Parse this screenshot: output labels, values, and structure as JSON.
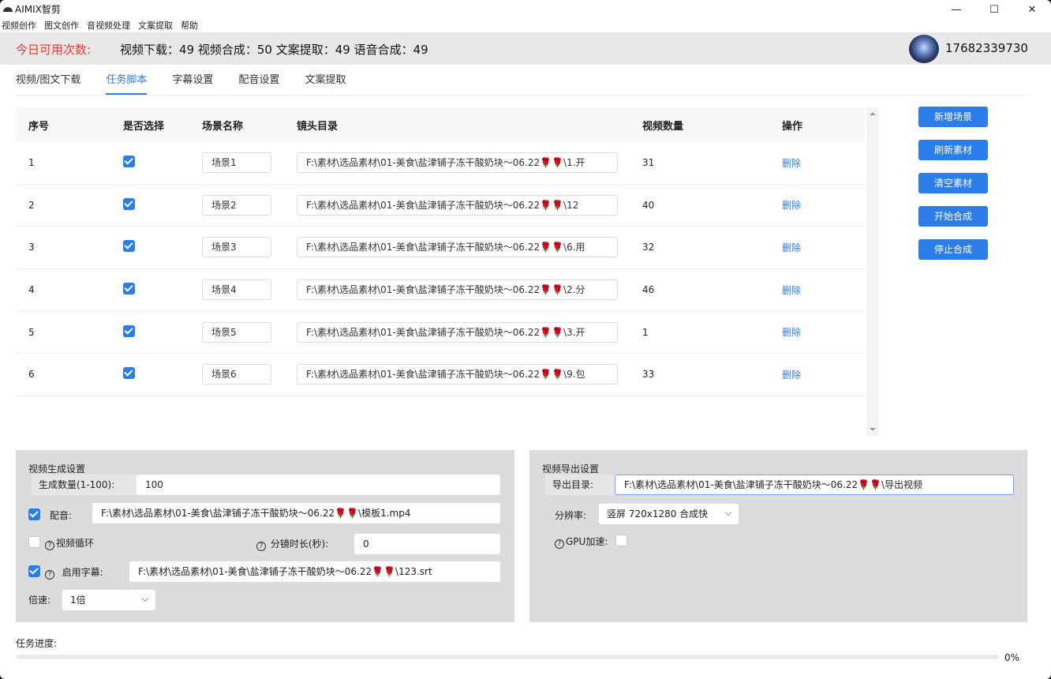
{
  "window": {
    "title": "AIMIX智剪",
    "min_glyph": "—",
    "max_glyph": "☐",
    "close_glyph": "✕"
  },
  "menu": [
    "视频创作",
    "图文创作",
    "音视频处理",
    "文案提取",
    "帮助"
  ],
  "quota": {
    "label": "今日可用次数:",
    "values": "视频下载：49 视频合成：50 文案提取：49 语音合成：49",
    "color": "#e8382f"
  },
  "user": {
    "phone": "17682339730"
  },
  "tabs": [
    "视频/图文下载",
    "任务脚本",
    "字幕设置",
    "配音设置",
    "文案提取"
  ],
  "active_tab": "任务脚本",
  "table": {
    "headers": [
      "序号",
      "是否选择",
      "场景名称",
      "镜头目录",
      "视频数量",
      "操作"
    ],
    "rows": [
      {
        "index": "1",
        "checked": true,
        "scene": "场景1",
        "dir": "F:\\素材\\选品素材\\01-美食\\盐津铺子冻干酸奶块～06.22🌹🌹\\1.开",
        "count": "31",
        "action": "删除"
      },
      {
        "index": "2",
        "checked": true,
        "scene": "场景2",
        "dir": "F:\\素材\\选品素材\\01-美食\\盐津铺子冻干酸奶块～06.22🌹🌹\\12",
        "count": "40",
        "action": "删除"
      },
      {
        "index": "3",
        "checked": true,
        "scene": "场景3",
        "dir": "F:\\素材\\选品素材\\01-美食\\盐津铺子冻干酸奶块～06.22🌹🌹\\6.用",
        "count": "32",
        "action": "删除"
      },
      {
        "index": "4",
        "checked": true,
        "scene": "场景4",
        "dir": "F:\\素材\\选品素材\\01-美食\\盐津铺子冻干酸奶块～06.22🌹🌹\\2.分",
        "count": "46",
        "action": "删除"
      },
      {
        "index": "5",
        "checked": true,
        "scene": "场景5",
        "dir": "F:\\素材\\选品素材\\01-美食\\盐津铺子冻干酸奶块～06.22🌹🌹\\3.开",
        "count": "1",
        "action": "删除"
      },
      {
        "index": "6",
        "checked": true,
        "scene": "场景6",
        "dir": "F:\\素材\\选品素材\\01-美食\\盐津铺子冻干酸奶块～06.22🌹🌹\\9.包",
        "count": "33",
        "action": "删除"
      }
    ]
  },
  "side_buttons": [
    "新增场景",
    "刷新素材",
    "清空素材",
    "开始合成",
    "停止合成"
  ],
  "video_gen": {
    "title": "视频生成设置",
    "count_label": "生成数量(1-100):",
    "count_value": "100",
    "dub_label": "配音:",
    "dub_checked": true,
    "dub_value": "F:\\素材\\选品素材\\01-美食\\盐津铺子冻干酸奶块～06.22🌹🌹\\模板1.mp4",
    "loop_label": "视频循环",
    "loop_checked": false,
    "shot_label": "分镜时长(秒):",
    "shot_value": "0",
    "subtitle_label": "启用字幕:",
    "subtitle_checked": true,
    "subtitle_value": "F:\\素材\\选品素材\\01-美食\\盐津铺子冻干酸奶块～06.22🌹🌹\\123.srt",
    "speed_label": "倍速:",
    "speed_value": "1倍"
  },
  "video_export": {
    "title": "视频导出设置",
    "dir_label": "导出目录:",
    "dir_value": "F:\\素材\\选品素材\\01-美食\\盐津铺子冻干酸奶块～06.22🌹🌹\\导出视频",
    "res_label": "分辨率:",
    "res_value": "竖屏 720x1280 合成快",
    "gpu_label": "GPU加速:",
    "gpu_checked": false
  },
  "progress": {
    "label": "任务进度:",
    "percent_text": "0%",
    "value": 0
  },
  "help_glyph": "?",
  "colors": {
    "accent": "#2b7de9",
    "quota_label": "#e8382f",
    "panel_bg": "#dcdcdc"
  }
}
